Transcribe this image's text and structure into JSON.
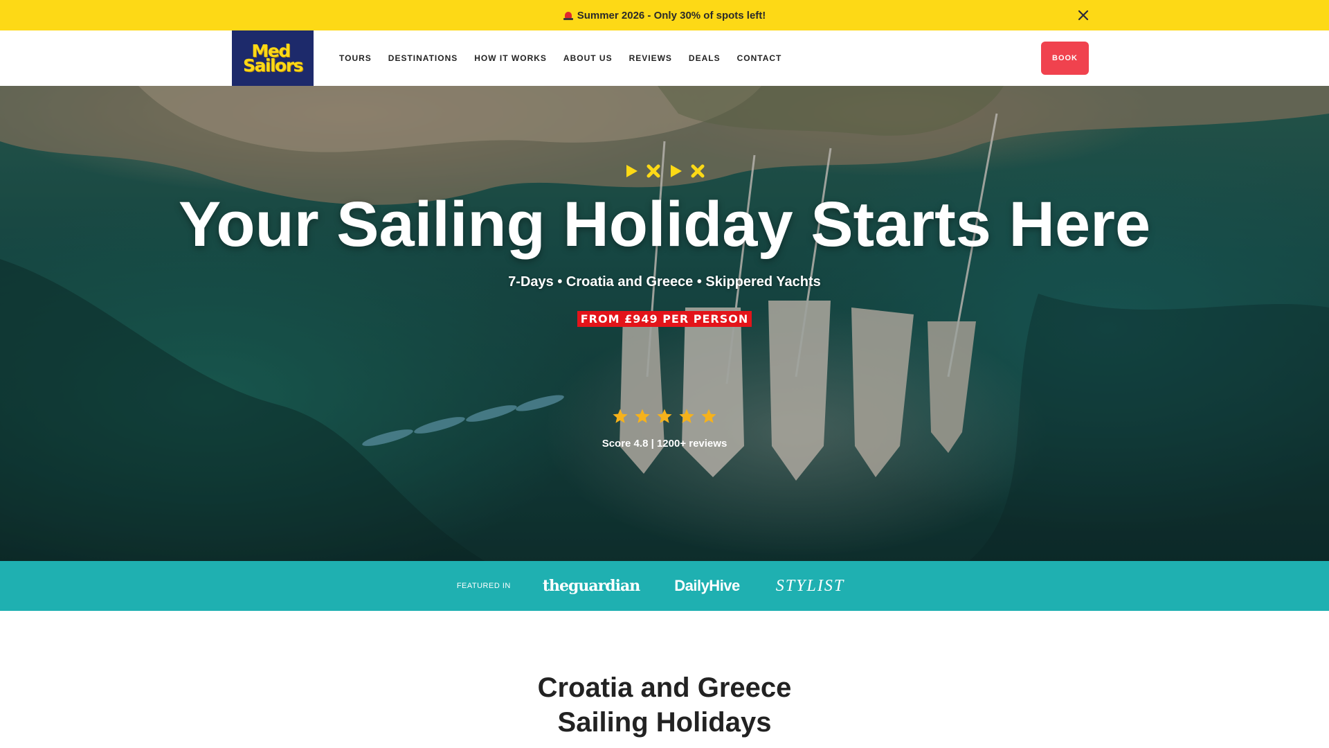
{
  "announcement": {
    "text": "Summer 2026 - Only 30% of spots left!",
    "icon": "siren-icon",
    "close_icon": "close-icon"
  },
  "header": {
    "logo": {
      "line1": "Med",
      "line2": "Sailors"
    },
    "nav": [
      {
        "label": "TOURS"
      },
      {
        "label": "DESTINATIONS"
      },
      {
        "label": "HOW IT WORKS"
      },
      {
        "label": "ABOUT US"
      },
      {
        "label": "REVIEWS"
      },
      {
        "label": "DEALS"
      },
      {
        "label": "CONTACT"
      }
    ],
    "book_label": "BOOK"
  },
  "hero": {
    "title": "Your Sailing Holiday Starts Here",
    "subtitle": "7-Days • Croatia and Greece • Skippered Yachts",
    "price_badge": "FROM £949 PER PERSON",
    "rating": {
      "stars": 5,
      "max_stars": 5,
      "score_text": "Score 4.8 | 1200+ reviews"
    },
    "icons": [
      "play-icon",
      "cross-icon",
      "play-icon",
      "cross-icon"
    ]
  },
  "featured": {
    "label": "FEATURED IN",
    "publications": [
      "theguardian",
      "DailyHive",
      "STYLIST"
    ]
  },
  "section": {
    "heading_line1": "Croatia and Greece",
    "heading_line2": "Sailing Holidays"
  },
  "colors": {
    "announcement_bg": "#FDD916",
    "logo_bg": "#1d2a6b",
    "logo_text": "#FDD916",
    "book_button": "#f0424e",
    "price_badge": "#e3141a",
    "featured_bg": "#1fb0b1",
    "star": "#f6b21b"
  }
}
